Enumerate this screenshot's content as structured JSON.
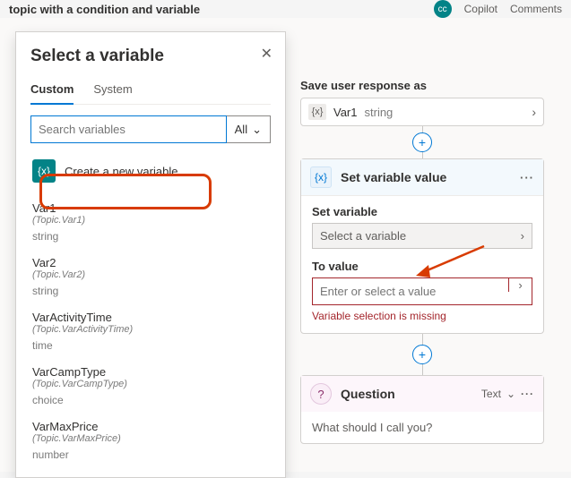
{
  "topbar": {
    "title_fragment": "topic with a condition and variable",
    "copilot": "Copilot",
    "comments": "Comments"
  },
  "flow": {
    "save_label": "Save user response as",
    "save_var_name": "Var1",
    "save_var_type": "string",
    "set_node_title": "Set variable value",
    "set_var_label": "Set variable",
    "set_var_placeholder": "Select a variable",
    "to_value_label": "To value",
    "to_value_placeholder": "Enter or select a value",
    "error_msg": "Variable selection is missing",
    "question_title": "Question",
    "question_type": "Text",
    "question_prompt": "What should I call you?"
  },
  "flyout": {
    "title": "Select a variable",
    "tabs": {
      "custom": "Custom",
      "system": "System"
    },
    "search_placeholder": "Search variables",
    "filter_label": "All",
    "create_label": "Create a new variable",
    "vars": [
      {
        "name": "Var1",
        "path": "(Topic.Var1)",
        "type": "string"
      },
      {
        "name": "Var2",
        "path": "(Topic.Var2)",
        "type": "string"
      },
      {
        "name": "VarActivityTime",
        "path": "(Topic.VarActivityTime)",
        "type": "time"
      },
      {
        "name": "VarCampType",
        "path": "(Topic.VarCampType)",
        "type": "choice"
      },
      {
        "name": "VarMaxPrice",
        "path": "(Topic.VarMaxPrice)",
        "type": "number"
      }
    ]
  },
  "colors": {
    "accent": "#0078d4",
    "teal": "#038387",
    "danger": "#a4262c",
    "callout": "#d83b01"
  }
}
